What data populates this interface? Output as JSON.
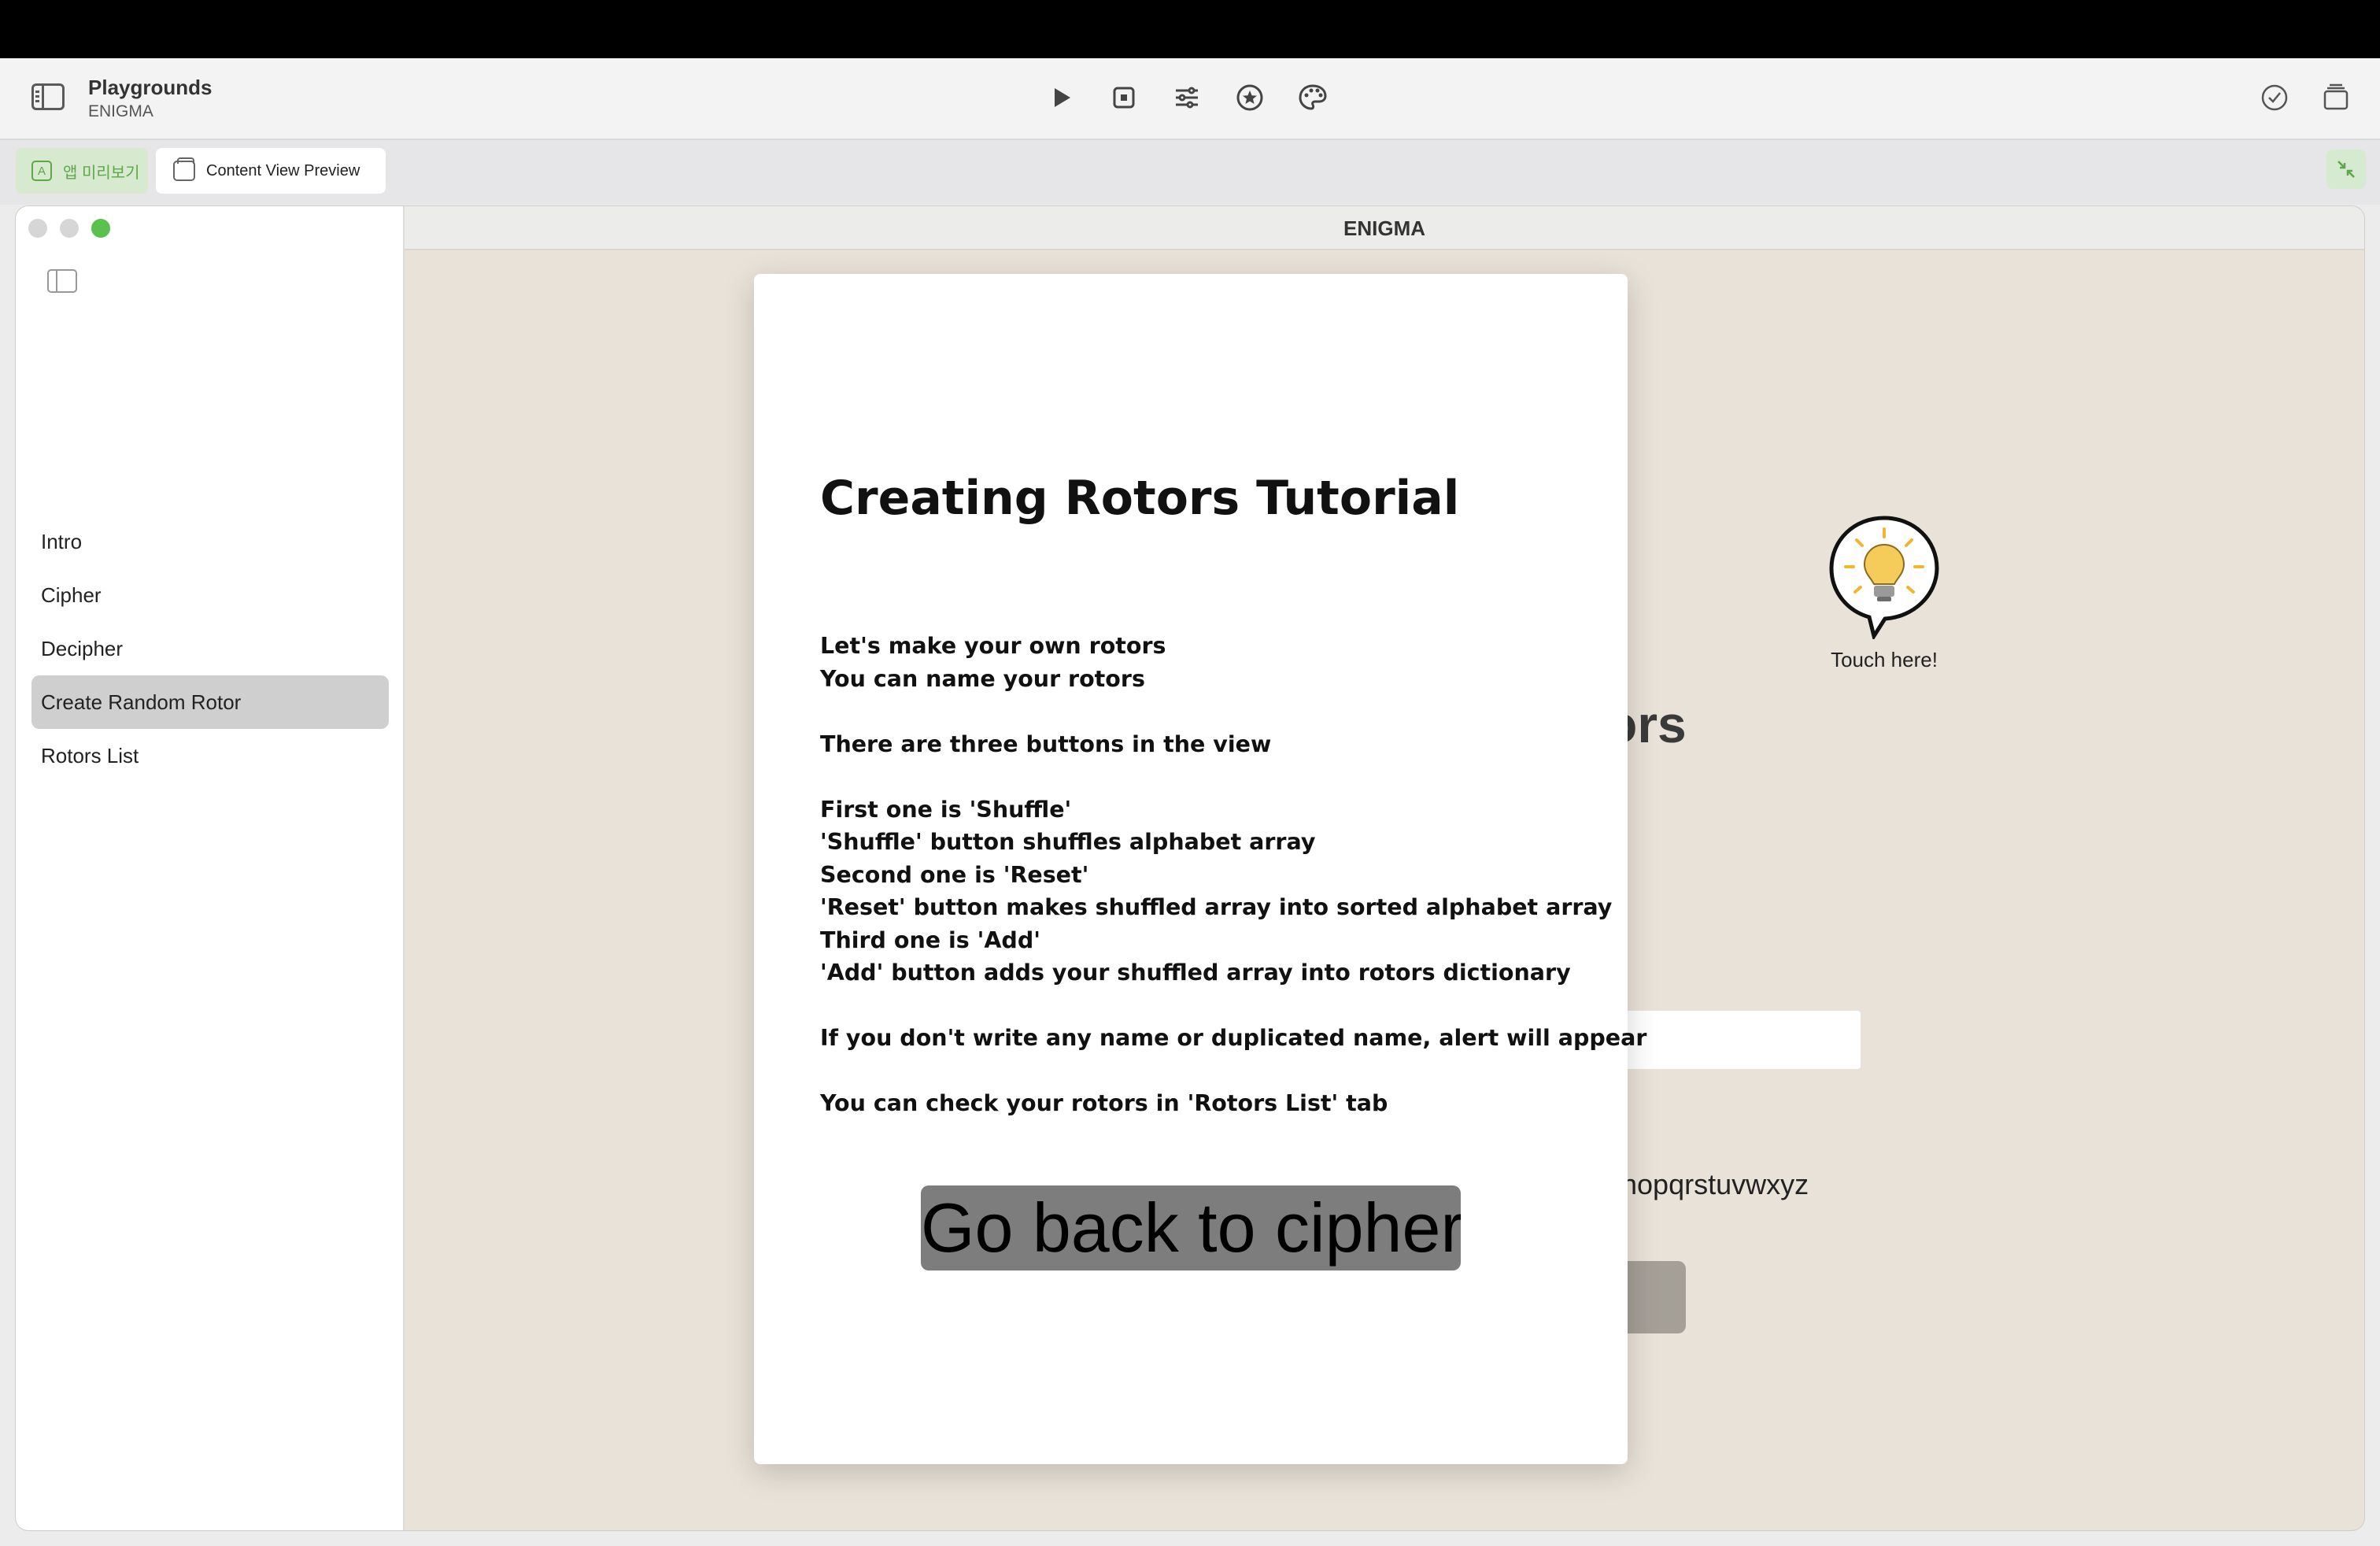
{
  "toolbar": {
    "title": "Playgrounds",
    "subtitle": "ENIGMA",
    "icons": [
      "sidebar-icon",
      "play-icon",
      "stop-icon",
      "sliders-icon",
      "star-icon",
      "palette-icon",
      "checkmark-icon",
      "windows-icon"
    ]
  },
  "tabs": {
    "app_preview": "앱 미리보기",
    "content_view_preview": "Content View Preview"
  },
  "window": {
    "title": "ENIGMA"
  },
  "sidebar": {
    "items": [
      {
        "label": "Intro"
      },
      {
        "label": "Cipher"
      },
      {
        "label": "Decipher"
      },
      {
        "label": "Create Random Rotor",
        "active": true
      },
      {
        "label": "Rotors List"
      }
    ]
  },
  "background": {
    "heading_fragment": "ors",
    "alphabet_fragment": "nopqrstuvwxyz"
  },
  "hint": {
    "label": "Touch here!"
  },
  "tutorial": {
    "title": "Creating Rotors Tutorial",
    "body": "Let's make your own rotors\nYou can name your rotors\n\nThere are three buttons in the view\n\nFirst one is 'Shuffle'\n'Shuffle' button shuffles alphabet array\nSecond one is 'Reset'\n'Reset' button makes shuffled array into sorted alphabet array\nThird one is 'Add'\n'Add' button adds your shuffled array into rotors dictionary\n\nIf you don't write any name or duplicated name, alert will appear\n\nYou can check your rotors in 'Rotors List' tab",
    "button_label": "Go back to cipher"
  },
  "colors": {
    "accent_green": "#5ea746",
    "window_bg": "#e9e2d8",
    "button_gray": "#7d7d7d"
  }
}
